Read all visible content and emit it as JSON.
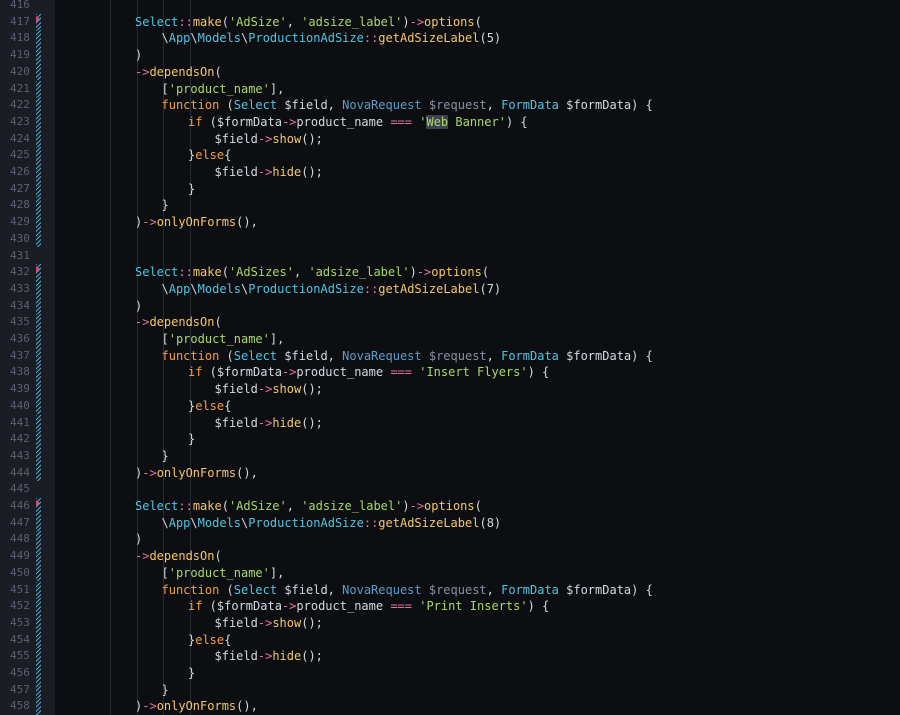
{
  "editor": {
    "language": "php",
    "colors": {
      "background": "#0d0e12",
      "gutter": "#1b1d25",
      "class": "#4fc6e0",
      "string": "#a8d86a",
      "method": "#f3c86a",
      "operator": "#e0789a",
      "type_hint": "#5a9ec9",
      "line_number": "#5b6070",
      "git_marker": "#4aa7c9"
    },
    "highlight_word": "Web",
    "lines": [
      {
        "n": "416",
        "indent": 0,
        "tokens": []
      },
      {
        "n": "417",
        "indent": 0,
        "tokens": [
          [
            "c",
            "Select"
          ],
          [
            "o",
            "::"
          ],
          [
            "f",
            "make"
          ],
          [
            "p",
            "("
          ],
          [
            "s",
            "'AdSize'"
          ],
          [
            "p",
            ", "
          ],
          [
            "s",
            "'adsize_label'"
          ],
          [
            "p",
            ")"
          ],
          [
            "o",
            "->"
          ],
          [
            "f",
            "options"
          ],
          [
            "p",
            "("
          ]
        ]
      },
      {
        "n": "418",
        "indent": 1,
        "tokens": [
          [
            "p",
            "\\"
          ],
          [
            "c",
            "App"
          ],
          [
            "p",
            "\\"
          ],
          [
            "c",
            "Models"
          ],
          [
            "p",
            "\\"
          ],
          [
            "c",
            "ProductionAdSize"
          ],
          [
            "o",
            "::"
          ],
          [
            "f",
            "getAdSizeLabel"
          ],
          [
            "p",
            "("
          ],
          [
            "p",
            "5"
          ],
          [
            "p",
            ")"
          ]
        ]
      },
      {
        "n": "419",
        "indent": 0,
        "tokens": [
          [
            "p",
            ")"
          ]
        ]
      },
      {
        "n": "420",
        "indent": 0,
        "tokens": [
          [
            "o",
            "->"
          ],
          [
            "f",
            "dependsOn"
          ],
          [
            "p",
            "("
          ]
        ]
      },
      {
        "n": "421",
        "indent": 1,
        "tokens": [
          [
            "p",
            "["
          ],
          [
            "s",
            "'product_name'"
          ],
          [
            "p",
            "],"
          ]
        ]
      },
      {
        "n": "422",
        "indent": 1,
        "tokens": [
          [
            "k",
            "function"
          ],
          [
            "p",
            " ("
          ],
          [
            "c",
            "Select"
          ],
          [
            "p",
            " $field, "
          ],
          [
            "t",
            "NovaRequest"
          ],
          [
            "d",
            " $request"
          ],
          [
            "p",
            ", "
          ],
          [
            "c",
            "FormData"
          ],
          [
            "p",
            " $formData) {"
          ]
        ]
      },
      {
        "n": "423",
        "indent": 2,
        "tokens": [
          [
            "k",
            "if"
          ],
          [
            "p",
            " ($formData"
          ],
          [
            "o",
            "->"
          ],
          [
            "p",
            "product_name "
          ],
          [
            "o",
            "==="
          ],
          [
            "p",
            " "
          ],
          [
            "s",
            "'"
          ],
          [
            "h",
            "Web"
          ],
          [
            "s",
            " Banner'"
          ],
          [
            "p",
            ") {"
          ]
        ]
      },
      {
        "n": "424",
        "indent": 3,
        "tokens": [
          [
            "p",
            "$field"
          ],
          [
            "o",
            "->"
          ],
          [
            "f",
            "show"
          ],
          [
            "p",
            "();"
          ]
        ]
      },
      {
        "n": "425",
        "indent": 2,
        "tokens": [
          [
            "p",
            "}"
          ],
          [
            "k",
            "else"
          ],
          [
            "p",
            "{"
          ]
        ]
      },
      {
        "n": "426",
        "indent": 3,
        "tokens": [
          [
            "p",
            "$field"
          ],
          [
            "o",
            "->"
          ],
          [
            "f",
            "hide"
          ],
          [
            "p",
            "();"
          ]
        ]
      },
      {
        "n": "427",
        "indent": 2,
        "tokens": [
          [
            "p",
            "}"
          ]
        ]
      },
      {
        "n": "428",
        "indent": 1,
        "tokens": [
          [
            "p",
            "}"
          ]
        ]
      },
      {
        "n": "429",
        "indent": 0,
        "tokens": [
          [
            "p",
            ")"
          ],
          [
            "o",
            "->"
          ],
          [
            "f",
            "onlyOnForms"
          ],
          [
            "p",
            "(),"
          ]
        ]
      },
      {
        "n": "430",
        "indent": 0,
        "tokens": []
      },
      {
        "n": "431",
        "indent": 0,
        "tokens": []
      },
      {
        "n": "432",
        "indent": 0,
        "tokens": [
          [
            "c",
            "Select"
          ],
          [
            "o",
            "::"
          ],
          [
            "f",
            "make"
          ],
          [
            "p",
            "("
          ],
          [
            "s",
            "'AdSizes'"
          ],
          [
            "p",
            ", "
          ],
          [
            "s",
            "'adsize_label'"
          ],
          [
            "p",
            ")"
          ],
          [
            "o",
            "->"
          ],
          [
            "f",
            "options"
          ],
          [
            "p",
            "("
          ]
        ]
      },
      {
        "n": "433",
        "indent": 1,
        "tokens": [
          [
            "p",
            "\\"
          ],
          [
            "c",
            "App"
          ],
          [
            "p",
            "\\"
          ],
          [
            "c",
            "Models"
          ],
          [
            "p",
            "\\"
          ],
          [
            "c",
            "ProductionAdSize"
          ],
          [
            "o",
            "::"
          ],
          [
            "f",
            "getAdSizeLabel"
          ],
          [
            "p",
            "("
          ],
          [
            "p",
            "7"
          ],
          [
            "p",
            ")"
          ]
        ]
      },
      {
        "n": "434",
        "indent": 0,
        "tokens": [
          [
            "p",
            ")"
          ]
        ]
      },
      {
        "n": "435",
        "indent": 0,
        "tokens": [
          [
            "o",
            "->"
          ],
          [
            "f",
            "dependsOn"
          ],
          [
            "p",
            "("
          ]
        ]
      },
      {
        "n": "436",
        "indent": 1,
        "tokens": [
          [
            "p",
            "["
          ],
          [
            "s",
            "'product_name'"
          ],
          [
            "p",
            "],"
          ]
        ]
      },
      {
        "n": "437",
        "indent": 1,
        "tokens": [
          [
            "k",
            "function"
          ],
          [
            "p",
            " ("
          ],
          [
            "c",
            "Select"
          ],
          [
            "p",
            " $field, "
          ],
          [
            "t",
            "NovaRequest"
          ],
          [
            "d",
            " $request"
          ],
          [
            "p",
            ", "
          ],
          [
            "c",
            "FormData"
          ],
          [
            "p",
            " $formData) {"
          ]
        ]
      },
      {
        "n": "438",
        "indent": 2,
        "tokens": [
          [
            "k",
            "if"
          ],
          [
            "p",
            " ($formData"
          ],
          [
            "o",
            "->"
          ],
          [
            "p",
            "product_name "
          ],
          [
            "o",
            "==="
          ],
          [
            "p",
            " "
          ],
          [
            "s",
            "'Insert Flyers'"
          ],
          [
            "p",
            ") {"
          ]
        ]
      },
      {
        "n": "439",
        "indent": 3,
        "tokens": [
          [
            "p",
            "$field"
          ],
          [
            "o",
            "->"
          ],
          [
            "f",
            "show"
          ],
          [
            "p",
            "();"
          ]
        ]
      },
      {
        "n": "440",
        "indent": 2,
        "tokens": [
          [
            "p",
            "}"
          ],
          [
            "k",
            "else"
          ],
          [
            "p",
            "{"
          ]
        ]
      },
      {
        "n": "441",
        "indent": 3,
        "tokens": [
          [
            "p",
            "$field"
          ],
          [
            "o",
            "->"
          ],
          [
            "f",
            "hide"
          ],
          [
            "p",
            "();"
          ]
        ]
      },
      {
        "n": "442",
        "indent": 2,
        "tokens": [
          [
            "p",
            "}"
          ]
        ]
      },
      {
        "n": "443",
        "indent": 1,
        "tokens": [
          [
            "p",
            "}"
          ]
        ]
      },
      {
        "n": "444",
        "indent": 0,
        "tokens": [
          [
            "p",
            ")"
          ],
          [
            "o",
            "->"
          ],
          [
            "f",
            "onlyOnForms"
          ],
          [
            "p",
            "(),"
          ]
        ]
      },
      {
        "n": "445",
        "indent": 0,
        "tokens": []
      },
      {
        "n": "446",
        "indent": 0,
        "tokens": [
          [
            "c",
            "Select"
          ],
          [
            "o",
            "::"
          ],
          [
            "f",
            "make"
          ],
          [
            "p",
            "("
          ],
          [
            "s",
            "'AdSize'"
          ],
          [
            "p",
            ", "
          ],
          [
            "s",
            "'adsize_label'"
          ],
          [
            "p",
            ")"
          ],
          [
            "o",
            "->"
          ],
          [
            "f",
            "options"
          ],
          [
            "p",
            "("
          ]
        ]
      },
      {
        "n": "447",
        "indent": 1,
        "tokens": [
          [
            "p",
            "\\"
          ],
          [
            "c",
            "App"
          ],
          [
            "p",
            "\\"
          ],
          [
            "c",
            "Models"
          ],
          [
            "p",
            "\\"
          ],
          [
            "c",
            "ProductionAdSize"
          ],
          [
            "o",
            "::"
          ],
          [
            "f",
            "getAdSizeLabel"
          ],
          [
            "p",
            "("
          ],
          [
            "p",
            "8"
          ],
          [
            "p",
            ")"
          ]
        ]
      },
      {
        "n": "448",
        "indent": 0,
        "tokens": [
          [
            "p",
            ")"
          ]
        ]
      },
      {
        "n": "449",
        "indent": 0,
        "tokens": [
          [
            "o",
            "->"
          ],
          [
            "f",
            "dependsOn"
          ],
          [
            "p",
            "("
          ]
        ]
      },
      {
        "n": "450",
        "indent": 1,
        "tokens": [
          [
            "p",
            "["
          ],
          [
            "s",
            "'product_name'"
          ],
          [
            "p",
            "],"
          ]
        ]
      },
      {
        "n": "451",
        "indent": 1,
        "tokens": [
          [
            "k",
            "function"
          ],
          [
            "p",
            " ("
          ],
          [
            "c",
            "Select"
          ],
          [
            "p",
            " $field, "
          ],
          [
            "t",
            "NovaRequest"
          ],
          [
            "d",
            " $request"
          ],
          [
            "p",
            ", "
          ],
          [
            "c",
            "FormData"
          ],
          [
            "p",
            " $formData) {"
          ]
        ]
      },
      {
        "n": "452",
        "indent": 2,
        "tokens": [
          [
            "k",
            "if"
          ],
          [
            "p",
            " ($formData"
          ],
          [
            "o",
            "->"
          ],
          [
            "p",
            "product_name "
          ],
          [
            "o",
            "==="
          ],
          [
            "p",
            " "
          ],
          [
            "s",
            "'Print Inserts'"
          ],
          [
            "p",
            ") {"
          ]
        ]
      },
      {
        "n": "453",
        "indent": 3,
        "tokens": [
          [
            "p",
            "$field"
          ],
          [
            "o",
            "->"
          ],
          [
            "f",
            "show"
          ],
          [
            "p",
            "();"
          ]
        ]
      },
      {
        "n": "454",
        "indent": 2,
        "tokens": [
          [
            "p",
            "}"
          ],
          [
            "k",
            "else"
          ],
          [
            "p",
            "{"
          ]
        ]
      },
      {
        "n": "455",
        "indent": 3,
        "tokens": [
          [
            "p",
            "$field"
          ],
          [
            "o",
            "->"
          ],
          [
            "f",
            "hide"
          ],
          [
            "p",
            "();"
          ]
        ]
      },
      {
        "n": "456",
        "indent": 2,
        "tokens": [
          [
            "p",
            "}"
          ]
        ]
      },
      {
        "n": "457",
        "indent": 1,
        "tokens": [
          [
            "p",
            "}"
          ]
        ]
      },
      {
        "n": "458",
        "indent": 0,
        "tokens": [
          [
            "p",
            ")"
          ],
          [
            "o",
            "->"
          ],
          [
            "f",
            "onlyOnForms"
          ],
          [
            "p",
            "(),"
          ]
        ]
      }
    ],
    "marked_lines": [
      "417",
      "418",
      "419",
      "420",
      "421",
      "422",
      "423",
      "424",
      "425",
      "426",
      "427",
      "428",
      "429",
      "430",
      "432",
      "433",
      "434",
      "435",
      "436",
      "437",
      "438",
      "439",
      "440",
      "441",
      "442",
      "443",
      "444",
      "446",
      "447",
      "448",
      "449",
      "450",
      "451",
      "452",
      "453",
      "454",
      "455",
      "456",
      "457",
      "458"
    ],
    "marker_starts": [
      "417",
      "432",
      "446"
    ]
  }
}
